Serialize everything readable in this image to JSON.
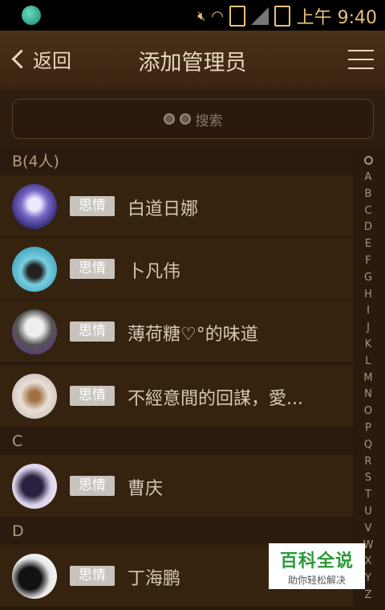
{
  "status_bar": {
    "time": "上午 9:40",
    "icons": [
      "app-icon",
      "mute-icon",
      "wifi-icon",
      "sim-unknown-icon",
      "signal-icon",
      "battery-icon"
    ]
  },
  "header": {
    "back_label": "返回",
    "title": "添加管理员",
    "menu_icon": "menu-icon"
  },
  "search": {
    "placeholder": "搜索",
    "icon": "binoculars-icon"
  },
  "sections": [
    {
      "title": "B(4人)",
      "items": [
        {
          "tag": "思情",
          "name": "白道日娜"
        },
        {
          "tag": "思情",
          "name": "卜凡伟"
        },
        {
          "tag": "思情",
          "name": "薄荷糖♡°的味道"
        },
        {
          "tag": "思情",
          "name": "不經意間的回謀，愛..."
        }
      ]
    },
    {
      "title": "C",
      "items": [
        {
          "tag": "思情",
          "name": "曹庆"
        }
      ]
    },
    {
      "title": "D",
      "items": [
        {
          "tag": "思情",
          "name": "丁海鹏"
        }
      ]
    }
  ],
  "index_bar": [
    "A",
    "B",
    "C",
    "D",
    "E",
    "F",
    "G",
    "H",
    "I",
    "J",
    "K",
    "L",
    "M",
    "N",
    "O",
    "P",
    "Q",
    "R",
    "S",
    "T",
    "U",
    "V",
    "W",
    "X",
    "Y",
    "Z"
  ],
  "watermark": {
    "title": "百科全说",
    "subtitle": "助你轻松解决"
  }
}
